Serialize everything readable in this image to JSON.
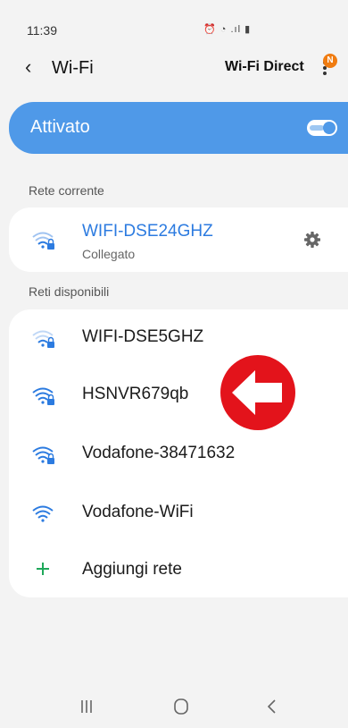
{
  "status_bar": {
    "time": "11:39",
    "icons_text": "⏰ ◔ .ıl ▮"
  },
  "header": {
    "back_label": "‹",
    "title": "Wi-Fi",
    "wifi_direct_label": "Wi-Fi Direct",
    "notification_badge": "N"
  },
  "toggle": {
    "label": "Attivato",
    "state": "on",
    "accent_color": "#4f99e8"
  },
  "current_network": {
    "section_label": "Rete corrente",
    "name": "WIFI-DSE24GHZ",
    "status": "Collegato",
    "name_color": "#2c7be0",
    "icon": "wifi-lock-icon"
  },
  "available": {
    "section_label": "Reti disponibili",
    "networks": [
      {
        "name": "WIFI-DSE5GHZ",
        "icon": "wifi-lock-icon",
        "signal": "weak"
      },
      {
        "name": "HSNVR679qb",
        "icon": "wifi-lock-icon",
        "signal": "strong"
      },
      {
        "name": "Vodafone-38471632",
        "icon": "wifi-lock-icon",
        "signal": "strong"
      },
      {
        "name": "Vodafone-WiFi",
        "icon": "wifi-icon",
        "signal": "strong"
      }
    ],
    "add_network_label": "Aggiungi rete",
    "add_icon_color": "#1fa85a"
  },
  "annotation": {
    "icon": "red-arrow-left-icon",
    "color": "#e3131b"
  },
  "nav": {
    "recents": "recent-apps-icon",
    "home": "home-icon",
    "back": "back-icon"
  }
}
